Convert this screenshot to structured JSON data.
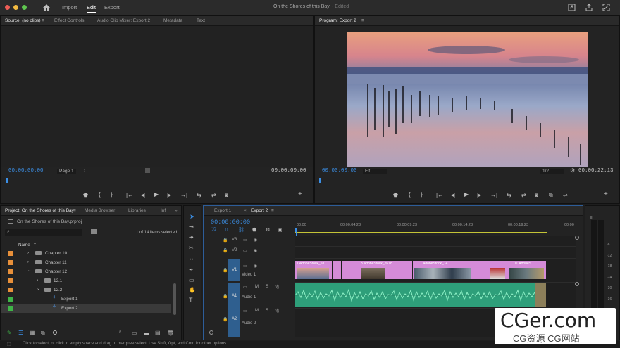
{
  "app": {
    "title": "On the Shores of this Bay",
    "edited": "- Edited"
  },
  "menu": {
    "import": "Import",
    "edit": "Edit",
    "export": "Export"
  },
  "source_panel": {
    "tabs": [
      "Source: (no clips)",
      "Effect Controls",
      "Audio Clip Mixer: Export 2",
      "Metadata",
      "Text"
    ],
    "timecode_left": "00:00:00:00",
    "page": "Page 1",
    "timecode_right": "00:00:00:00"
  },
  "program_panel": {
    "tab": "Program: Export 2",
    "timecode_left": "00:00:00:00",
    "fit": "Fit",
    "resolution": "1/2",
    "timecode_right": "00:00:22:13"
  },
  "project_panel": {
    "tabs": [
      "Project: On the Shores of this Bay",
      "Media Browser",
      "Libraries",
      "Inf"
    ],
    "file": "On the Shores of this Bay.prproj",
    "items_selected": "1 of 14 items selected",
    "column_name": "Name",
    "rows": [
      {
        "label": "Chapter 10",
        "color": "#e8903a"
      },
      {
        "label": "Chapter 11",
        "color": "#e8903a"
      },
      {
        "label": "Chapter 12",
        "color": "#e8903a"
      },
      {
        "label": "12.1",
        "color": "#e8903a"
      },
      {
        "label": "12.2",
        "color": "#e8903a"
      },
      {
        "label": "Export 1",
        "color": "#3fb548"
      },
      {
        "label": "Export 2",
        "color": "#3fb548"
      }
    ]
  },
  "timeline": {
    "tabs": [
      "Export 1",
      "Export 2"
    ],
    "timecode": "00:00:00:00",
    "ruler": [
      "00:00",
      "00:00:04:23",
      "00:00:09:23",
      "00:00:14:23",
      "00:00:19:23",
      "00:00"
    ],
    "tracks": [
      {
        "id": "V3",
        "name": ""
      },
      {
        "id": "V2",
        "name": ""
      },
      {
        "id": "V1",
        "name": "Video 1"
      },
      {
        "id": "A1",
        "name": "Audio 1"
      },
      {
        "id": "A2",
        "name": "Audio 2"
      }
    ],
    "clips": [
      "1 AdobeStock_18",
      "3 AdobeStock_2618",
      "AdobeStock_14",
      "11 AdobeS"
    ],
    "solo": "S",
    "mute": "M"
  },
  "meters": {
    "scale": [
      "-6",
      "-12",
      "-18",
      "-24",
      "-30",
      "-36",
      "-42",
      "-48"
    ]
  },
  "status": "Click to select, or click in empty space and drag to marquee select. Use Shift, Opt, and Cmd for other options.",
  "watermark": {
    "big": "CGer.com",
    "small": "CG资源 CG网站"
  },
  "colors": {
    "accent": "#3b8fe6",
    "video_clip": "#d58bd8",
    "audio_clip": "#3fb98b"
  }
}
